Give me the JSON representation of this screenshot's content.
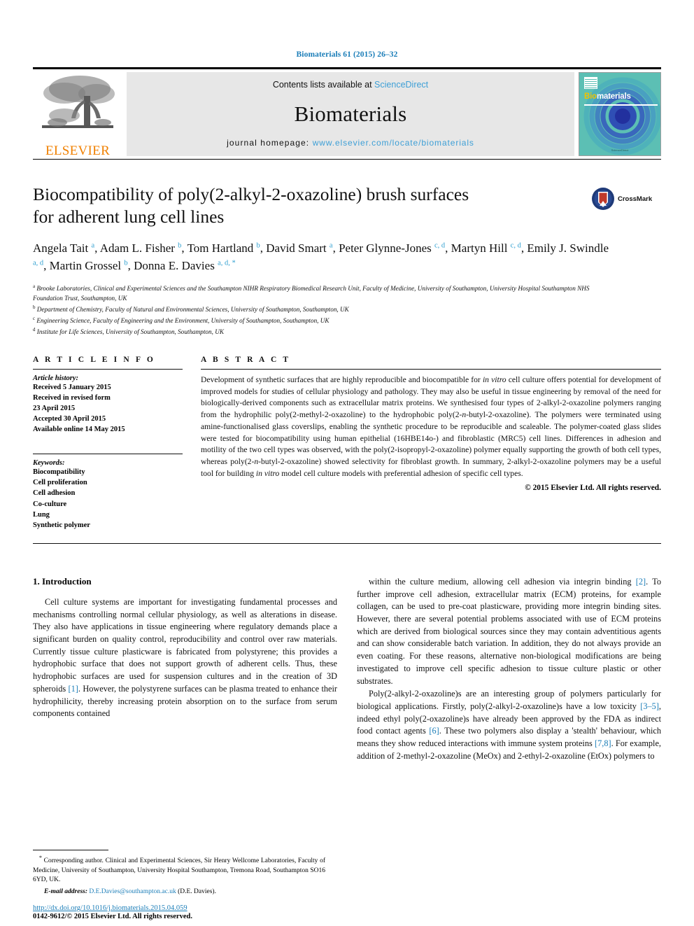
{
  "running_head": "Biomaterials 61 (2015) 26–32",
  "masthead": {
    "publisher_name": "ELSEVIER",
    "contents_prefix": "Contents lists available at ",
    "contents_link": "ScienceDirect",
    "journal_name": "Biomaterials",
    "homepage_prefix": "journal homepage: ",
    "homepage_link": "www.elsevier.com/locate/biomaterials",
    "cover_title_bio": "Bio",
    "cover_title_rest": "materials",
    "cover_footer": "ScienceDirect"
  },
  "article": {
    "title_line1": "Biocompatibility of poly(2-alkyl-2-oxazoline) brush surfaces",
    "title_line2": "for adherent lung cell lines",
    "crossmark_label": "CrossMark",
    "authors_html": "Angela Tait <sup>a</sup>, Adam L. Fisher <sup>b</sup>, Tom Hartland <sup>b</sup>, David Smart <sup>a</sup>, Peter Glynne-Jones <sup>c, d</sup>, Martyn Hill <sup>c, d</sup>, Emily J. Swindle <sup>a, d</sup>, Martin Grossel <sup>b</sup>, Donna E. Davies <sup>a, d, *</sup>",
    "affiliations": [
      "Brooke Laboratories, Clinical and Experimental Sciences and the Southampton NIHR Respiratory Biomedical Research Unit, Faculty of Medicine, University of Southampton, University Hospital Southampton NHS Foundation Trust, Southampton, UK",
      "Department of Chemistry, Faculty of Natural and Environmental Sciences, University of Southampton, Southampton, UK",
      "Engineering Science, Faculty of Engineering and the Environment, University of Southampton, Southampton, UK",
      "Institute for Life Sciences, University of Southampton, Southampton, UK"
    ],
    "affiliation_marks": [
      "a",
      "b",
      "c",
      "d"
    ]
  },
  "article_info": {
    "heading": "A R T I C L E   I N F O",
    "history_label": "Article history:",
    "history": [
      "Received 5 January 2015",
      "Received in revised form",
      "23 April 2015",
      "Accepted 30 April 2015",
      "Available online 14 May 2015"
    ],
    "keywords_label": "Keywords:",
    "keywords": [
      "Biocompatibility",
      "Cell proliferation",
      "Cell adhesion",
      "Co-culture",
      "Lung",
      "Synthetic polymer"
    ]
  },
  "abstract": {
    "heading": "A B S T R A C T",
    "text_html": "Development of synthetic surfaces that are highly reproducible and biocompatible for <i>in vitro</i> cell culture offers potential for development of improved models for studies of cellular physiology and pathology. They may also be useful in tissue engineering by removal of the need for biologically-derived components such as extracellular matrix proteins. We synthesised four types of 2-alkyl-2-oxazoline polymers ranging from the hydrophilic poly(2-methyl-2-oxazoline) to the hydrophobic poly(2-<i>n</i>-butyl-2-oxazoline). The polymers were terminated using amine-functionalised glass coverslips, enabling the synthetic procedure to be reproducible and scaleable. The polymer-coated glass slides were tested for biocompatibility using human epithelial (16HBE14o-) and fibroblastic (MRC5) cell lines. Differences in adhesion and motility of the two cell types was observed, with the poly(2-isopropyl-2-oxazoline) polymer equally supporting the growth of both cell types, whereas poly(2-<i>n</i>-butyl-2-oxazoline) showed selectivity for fibroblast growth. In summary, 2-alkyl-2-oxazoline polymers may be a useful tool for building <i>in vitro</i> model cell culture models with preferential adhesion of specific cell types.",
    "copyright": "© 2015 Elsevier Ltd. All rights reserved."
  },
  "introduction": {
    "heading": "1. Introduction",
    "left_paragraph_html": "Cell culture systems are important for investigating fundamental processes and mechanisms controlling normal cellular physiology, as well as alterations in disease. They also have applications in tissue engineering where regulatory demands place a significant burden on quality control, reproducibility and control over raw materials. Currently tissue culture plasticware is fabricated from polystyrene; this provides a hydrophobic surface that does not support growth of adherent cells. Thus, these hydrophobic surfaces are used for suspension cultures and in the creation of 3D spheroids <span class=\"ref\">[1]</span>. However, the polystyrene surfaces can be plasma treated to enhance their hydrophilicity, thereby increasing protein absorption on to the surface from serum components contained",
    "right_paragraph1_html": "within the culture medium, allowing cell adhesion via integrin binding <span class=\"ref\">[2]</span>. To further improve cell adhesion, extracellular matrix (ECM) proteins, for example collagen, can be used to pre-coat plasticware, providing more integrin binding sites. However, there are several potential problems associated with use of ECM proteins which are derived from biological sources since they may contain adventitious agents and can show considerable batch variation. In addition, they do not always provide an even coating. For these reasons, alternative non-biological modifications are being investigated to improve cell specific adhesion to tissue culture plastic or other substrates.",
    "right_paragraph2_html": "Poly(2-alkyl-2-oxazoline)s are an interesting group of polymers particularly for biological applications. Firstly, poly(2-alkyl-2-oxazoline)s have a low toxicity <span class=\"ref\">[3–5]</span>, indeed ethyl poly(2-oxazoline)s have already been approved by the FDA as indirect food contact agents <span class=\"ref\">[6]</span>. These two polymers also display a 'stealth' behaviour, which means they show reduced interactions with immune system proteins <span class=\"ref\">[7,8]</span>. For example, addition of 2-methyl-2-oxazoline (MeOx) and 2-ethyl-2-oxazoline (EtOx) polymers to"
  },
  "footnote": {
    "corresponding_html": "<sup>*</sup> Corresponding author. Clinical and Experimental Sciences, Sir Henry Wellcome Laboratories, Faculty of Medicine, University of Southampton, University Hospital Southampton, Tremona Road, Southampton SO16 6YD, UK.",
    "email_label": "E-mail address:",
    "email": "D.E.Davies@southampton.ac.uk",
    "email_owner": "(D.E. Davies)."
  },
  "doi": {
    "link": "http://dx.doi.org/10.1016/j.biomaterials.2015.04.059",
    "issn_line": "0142-9612/© 2015 Elsevier Ltd. All rights reserved."
  },
  "colors": {
    "link_blue": "#1a7db8",
    "masthead_link": "#3d9fd6",
    "elsevier_orange": "#f08000",
    "cover_teal": "#5cbfb4",
    "superscript_blue": "#2f9fd0"
  }
}
